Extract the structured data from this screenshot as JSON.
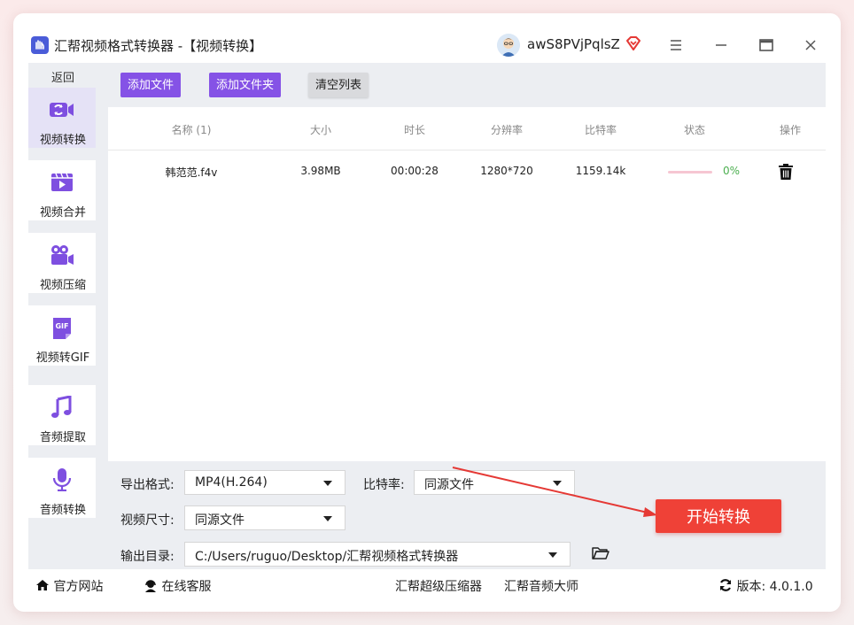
{
  "window": {
    "title": "汇帮视频格式转换器 -【视频转换】",
    "username": "awS8PVjPqlsZ"
  },
  "sidebar": {
    "back_label": "返回",
    "items": [
      {
        "label": "视频转换",
        "icon": "video-convert-icon",
        "active": true
      },
      {
        "label": "视频合并",
        "icon": "video-merge-icon",
        "active": false
      },
      {
        "label": "视频压缩",
        "icon": "video-compress-icon",
        "active": false
      },
      {
        "label": "视频转GIF",
        "icon": "gif-icon",
        "active": false
      },
      {
        "label": "音频提取",
        "icon": "music-note-icon",
        "active": false
      },
      {
        "label": "音频转换",
        "icon": "microphone-icon",
        "active": false
      }
    ]
  },
  "toolbar": {
    "add_file": "添加文件",
    "add_folder": "添加文件夹",
    "clear_list": "清空列表"
  },
  "table": {
    "headers": [
      "名称 (1)",
      "大小",
      "时长",
      "分辨率",
      "比特率",
      "状态",
      "操作"
    ],
    "rows": [
      {
        "name": "韩范范.f4v",
        "size": "3.98MB",
        "duration": "00:00:28",
        "resolution": "1280*720",
        "bitrate": "1159.14k",
        "progress": 0,
        "progress_text": "0%"
      }
    ]
  },
  "settings": {
    "format_label": "导出格式:",
    "format_value": "MP4(H.264)",
    "bitrate_label": "比特率:",
    "bitrate_value": "同源文件",
    "size_label": "视频尺寸:",
    "size_value": "同源文件",
    "output_label": "输出目录:",
    "output_value": "C:/Users/ruguo/Desktop/汇帮视频格式转换器"
  },
  "start_button": "开始转换",
  "footer": {
    "website": "官方网站",
    "support": "在线客服",
    "link1": "汇帮超级压缩器",
    "link2": "汇帮音频大师",
    "version": "版本: 4.0.1.0"
  },
  "colors": {
    "accent_purple": "#8552e6",
    "start_red": "#ef4137",
    "progress_green": "#4caf50"
  }
}
